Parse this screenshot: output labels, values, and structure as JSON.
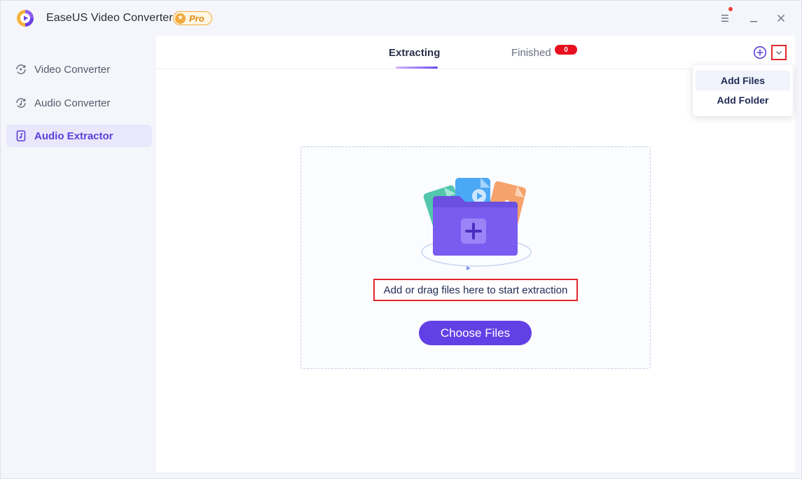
{
  "app": {
    "title": "EaseUS Video Converter",
    "badge": "Pro"
  },
  "sidebar": {
    "items": [
      {
        "label": "Video Converter",
        "icon": "video-convert-icon",
        "active": false
      },
      {
        "label": "Audio Converter",
        "icon": "audio-convert-icon",
        "active": false
      },
      {
        "label": "Audio Extractor",
        "icon": "audio-file-icon",
        "active": true
      }
    ]
  },
  "tabs": {
    "extracting": "Extracting",
    "finished": "Finished",
    "finished_count": "0"
  },
  "dropdown": {
    "items": [
      "Add Files",
      "Add Folder"
    ]
  },
  "dropzone": {
    "hint": "Add or drag files here to start extraction",
    "button": "Choose Files"
  },
  "colors": {
    "accent": "#6340e6",
    "highlight_box": "#e0282c",
    "badge": "#e8101f",
    "pro": "#f2a93b"
  }
}
